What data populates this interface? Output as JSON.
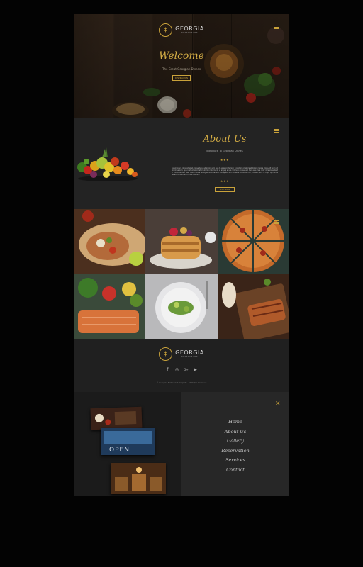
{
  "brand": {
    "name": "GEORGIA",
    "subtitle": "RESTAURANT",
    "mark": "‡"
  },
  "hero": {
    "title": "Welcome",
    "tagline": "The Great Georgian Dishes",
    "button": "RESERVATION"
  },
  "about": {
    "title": "About Us",
    "subtitle": "Introduce To Georgian Dishes",
    "stars": "★★★",
    "body": "Lorem ipsum dolor sit amet, consectetur adipiscing elit, sed do eiusmod tempor incididunt ut labore et dolore magna aliqua. Ut enim ad minim veniam, quis nostrud exercitation ullamco laboris nisi ut aliquip ex ea commodo consequat. Duis aute irure dolor in reprehenderit in voluptate velit esse cillum dolore eu fugiat nulla pariatur. Excepteur sint occaecat cupidatat non proident, sunt in culpa qui officia deserunt mollit anim id est laborum.",
    "button": "READ MORE"
  },
  "gallery": [
    "burrito",
    "pancakes",
    "pizza",
    "salmon-salad",
    "plated-dish",
    "grilled-fish"
  ],
  "footer": {
    "socials": [
      "facebook-icon",
      "instagram-icon",
      "google-plus-icon",
      "youtube-icon"
    ],
    "social_glyphs": [
      "f",
      "◎",
      "G+",
      "▶"
    ],
    "copyright": "© Georgian Restaurant Template - All Rights Reserved"
  },
  "nav": {
    "close": "✕",
    "items": [
      "Home",
      "About Us",
      "Gallery",
      "Reservation",
      "Services",
      "Contact"
    ]
  },
  "colors": {
    "accent": "#c9a23a",
    "background": "#1d1d1d",
    "outer": "#030303"
  }
}
